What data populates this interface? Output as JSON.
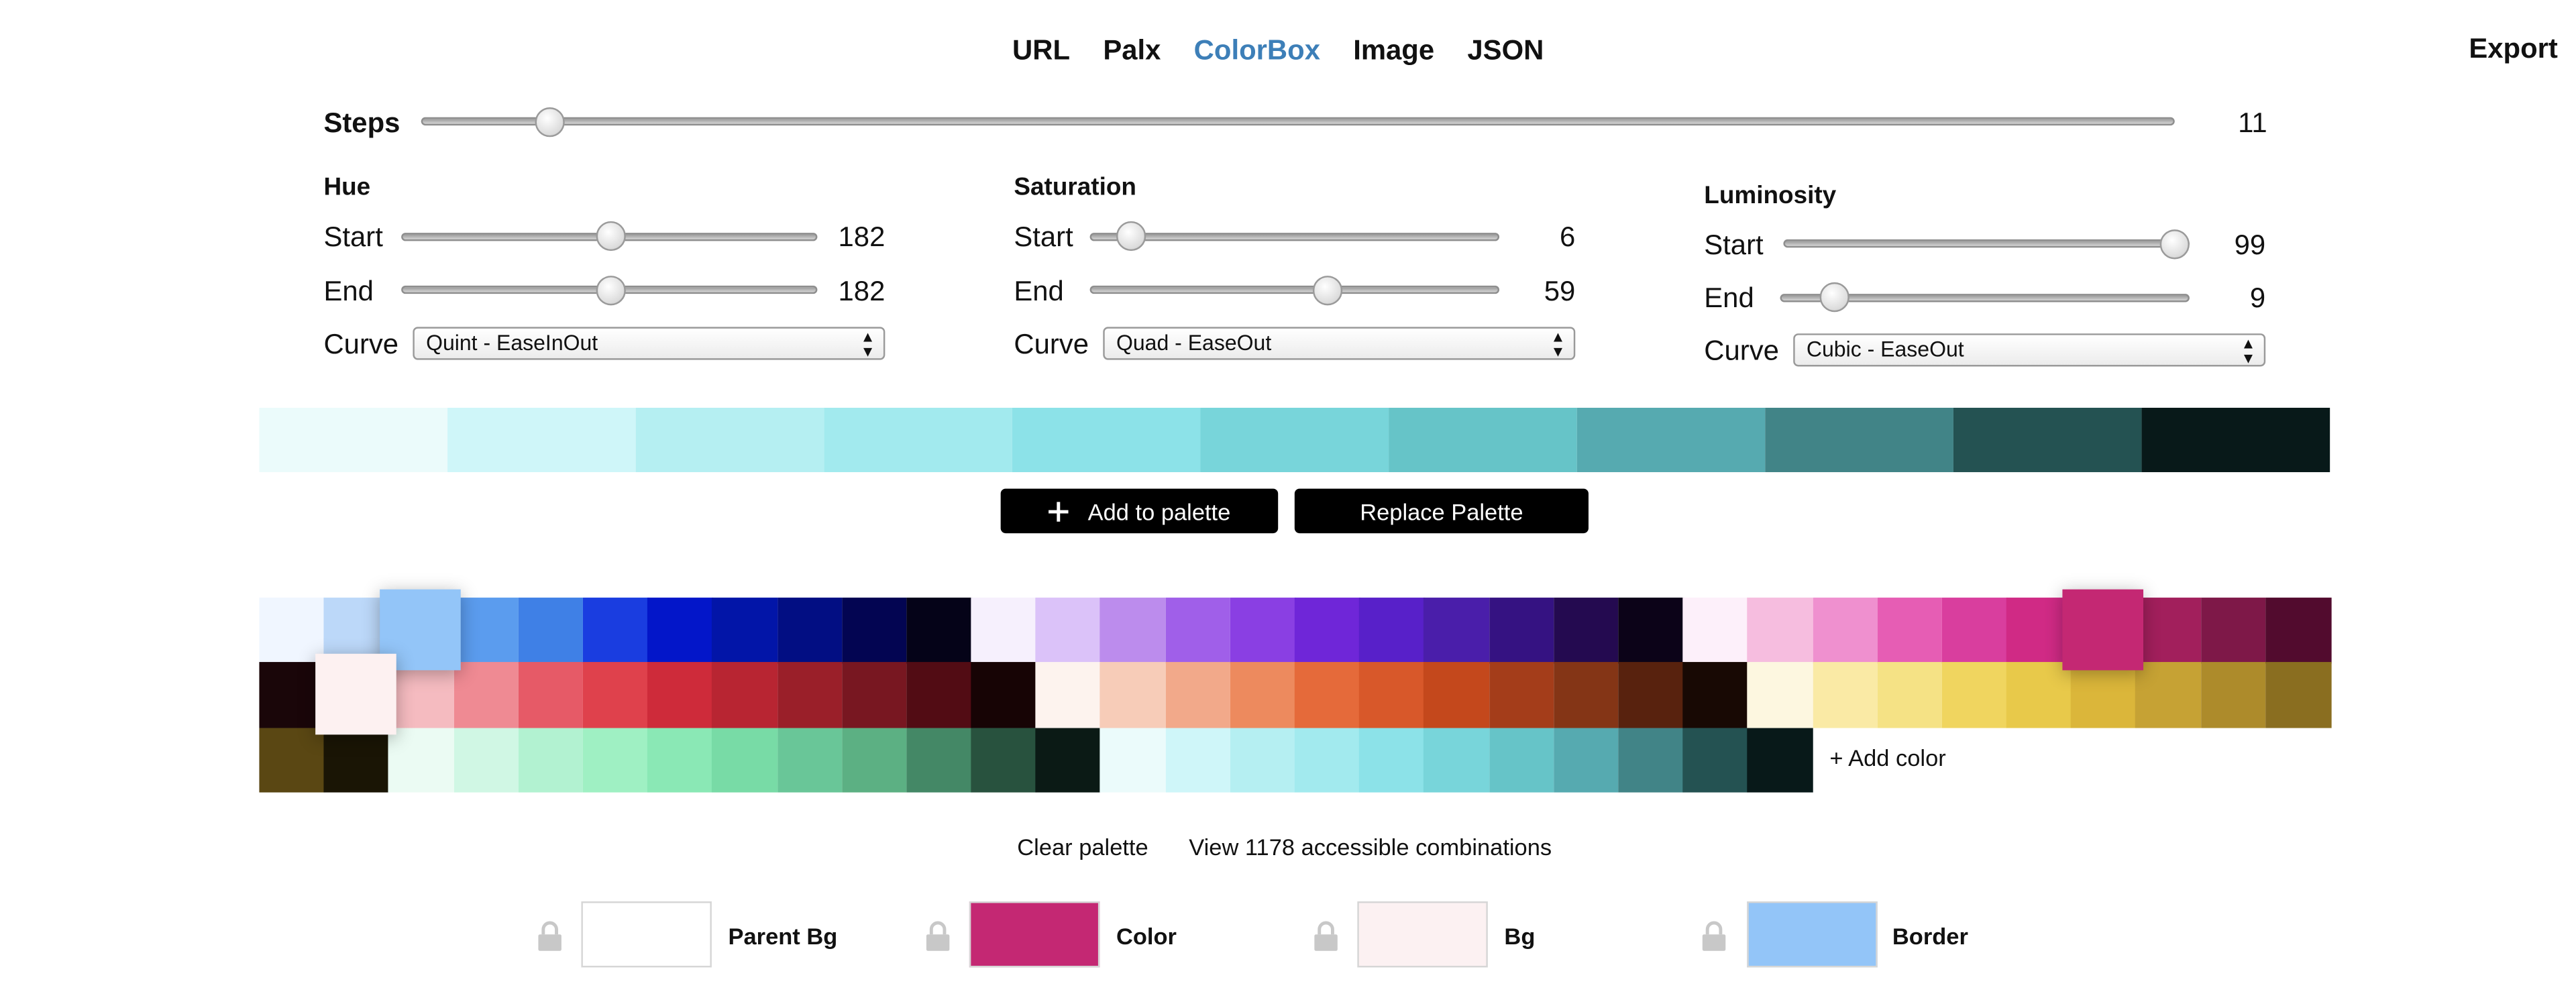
{
  "nav": {
    "tabs": [
      {
        "label": "URL"
      },
      {
        "label": "Palx"
      },
      {
        "label": "ColorBox",
        "active": true
      },
      {
        "label": "Image"
      },
      {
        "label": "JSON"
      }
    ],
    "export_label": "Export"
  },
  "steps": {
    "label": "Steps",
    "value": "11",
    "fraction": 0.071
  },
  "hue": {
    "title": "Hue",
    "start": {
      "label": "Start",
      "value": "182",
      "fraction": 0.5
    },
    "end": {
      "label": "End",
      "value": "182",
      "fraction": 0.5
    },
    "curve": {
      "label": "Curve",
      "value": "Quint - EaseInOut"
    }
  },
  "saturation": {
    "title": "Saturation",
    "start": {
      "label": "Start",
      "value": "6",
      "fraction": 0.06
    },
    "end": {
      "label": "End",
      "value": "59",
      "fraction": 0.59
    },
    "curve": {
      "label": "Curve",
      "value": "Quad - EaseOut"
    }
  },
  "luminosity": {
    "title": "Luminosity",
    "start": {
      "label": "Start",
      "value": "99",
      "fraction": 0.99
    },
    "end": {
      "label": "End",
      "value": "9",
      "fraction": 0.09
    },
    "curve": {
      "label": "Curve",
      "value": "Cubic - EaseOut"
    }
  },
  "generated_colors": [
    "#ebfbfb",
    "#cff6f9",
    "#b5eff2",
    "#a2eaee",
    "#8ce2e8",
    "#78d5da",
    "#66c4c8",
    "#56aab0",
    "#418487",
    "#245252",
    "#081919"
  ],
  "buttons": {
    "add_to_palette": "Add to palette",
    "replace_palette": "Replace Palette",
    "add_color": "+ Add color"
  },
  "palette": {
    "row1": [
      "#f0f6ff",
      "#bcd8f9",
      "#93c5f8",
      "#5b9cee",
      "#3f80e6",
      "#1a3de0",
      "#0316c9",
      "#0215a8",
      "#020e83",
      "#030552",
      "#050318",
      "#f6f0fd",
      "#dbc2f9",
      "#bc8ced",
      "#a05fe9",
      "#8a3fe3",
      "#6f26d8",
      "#5820c9",
      "#4a1eaa",
      "#351282",
      "#240a50",
      "#0c0318",
      "#fdf0fa",
      "#f6bddf",
      "#ef90cf",
      "#e65db4",
      "#d93e9e",
      "#d02a85",
      "#c42873",
      "#a21f5c",
      "#7e1848",
      "#520b2e"
    ],
    "row2": [
      "#1a0609",
      "#fdf1f1",
      "#f5bbc0",
      "#ef8a93",
      "#e65a67",
      "#df414c",
      "#ce2b3a",
      "#b82532",
      "#9a1f29",
      "#781721",
      "#520c14",
      "#170405",
      "#fdf3ee",
      "#f7ccb8",
      "#f2a98a",
      "#ed8a5e",
      "#e56a3a",
      "#d8582a",
      "#c4481c",
      "#a43d1a",
      "#843516",
      "#58220e",
      "#180904",
      "#fdf7e0",
      "#faeaa5",
      "#f5e285",
      "#f0d55f",
      "#e8c94a",
      "#dbb63a",
      "#c6a234",
      "#ad8b2b",
      "#8a6e20"
    ],
    "row3": [
      "#5a4713",
      "#1a1505",
      "#ebfbf3",
      "#d0f7e4",
      "#b2f2d1",
      "#9ff0c3",
      "#8ae8b5",
      "#78dba6",
      "#69c698",
      "#5cb083",
      "#448866",
      "#28523e",
      "#0b1a15",
      "#ebfbfb",
      "#cff6f9",
      "#b5eff2",
      "#a2eaee",
      "#8ce2e8",
      "#78d5da",
      "#66c4c8",
      "#56aab0",
      "#418487",
      "#245252",
      "#081919"
    ],
    "raised": [
      {
        "row": 0,
        "index": 2,
        "color": "#93c5f8"
      },
      {
        "row": 0,
        "index": 28,
        "color": "#c42873"
      },
      {
        "row": 1,
        "index": 1,
        "color": "#fdf1f1"
      }
    ]
  },
  "footer": {
    "clear_palette": "Clear palette",
    "view_combinations": "View 1178 accessible combinations"
  },
  "roles": [
    {
      "label": "Parent Bg",
      "color": "#ffffff"
    },
    {
      "label": "Color",
      "color": "#c42873"
    },
    {
      "label": "Bg",
      "color": "#fcf1f2"
    },
    {
      "label": "Border",
      "color": "#93c5f8"
    }
  ]
}
